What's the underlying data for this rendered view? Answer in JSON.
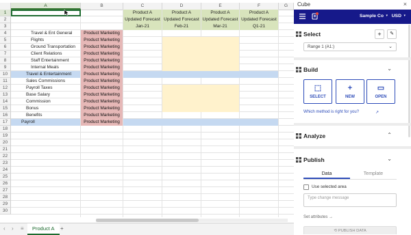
{
  "sheet": {
    "columns": [
      "A",
      "B",
      "C",
      "D",
      "E",
      "F",
      "G"
    ],
    "rows": [
      "1",
      "2",
      "3",
      "4",
      "5",
      "6",
      "7",
      "8",
      "9",
      "10",
      "11",
      "12",
      "13",
      "14",
      "15",
      "16",
      "17",
      "18",
      "19",
      "20",
      "21",
      "22",
      "23",
      "24",
      "25",
      "26",
      "27",
      "28",
      "29",
      "30"
    ],
    "header_c": [
      "Product A",
      "Updated Forecast",
      "Jan-21"
    ],
    "header_d": [
      "Product A",
      "Updated Forecast",
      "Feb-21"
    ],
    "header_e": [
      "Product A",
      "Updated Forecast",
      "Mar-21"
    ],
    "header_f": [
      "Product A",
      "Updated Forecast",
      "Q1-21"
    ],
    "col_a": {
      "r4": "Travel & Ent General",
      "r5": "Flights",
      "r6": "Ground Transportation",
      "r7": "Client Relations",
      "r8": "Staff Entertainment",
      "r9": "Internal Meals",
      "r10": "Travel & Entertainment",
      "r11": "Sales Commissions",
      "r12": "Payroll Taxes",
      "r13": "Base Salary",
      "r14": "Commission",
      "r15": "Bonus",
      "r16": "Benefits",
      "r17": "Payroll"
    },
    "col_b_label": "Product Marketing",
    "active_tab": "Product A",
    "colors": {
      "highlight": "#c5d9f1",
      "tag": "#e6b8b7",
      "header": "#d8e4bc",
      "input": "#fff2cc"
    }
  },
  "panel": {
    "title": "Cube",
    "close": "×",
    "company": "Sample Co",
    "currency": "USD",
    "select": {
      "heading": "Select",
      "range_value": "Range 1 (A1:)"
    },
    "build": {
      "heading": "Build",
      "buttons": [
        "SELECT",
        "NEW",
        "OPEN"
      ],
      "help_link": "Which method is right for you?"
    },
    "analyze": {
      "heading": "Analyze"
    },
    "publish": {
      "heading": "Publish",
      "tabs": [
        "Data",
        "Template"
      ],
      "checkbox_label": "Use selected area",
      "message_placeholder": "Type change message",
      "attributes_link": "Set attributes →",
      "publish_button": "PUBLISH DATA"
    },
    "accent": "#16198a"
  }
}
